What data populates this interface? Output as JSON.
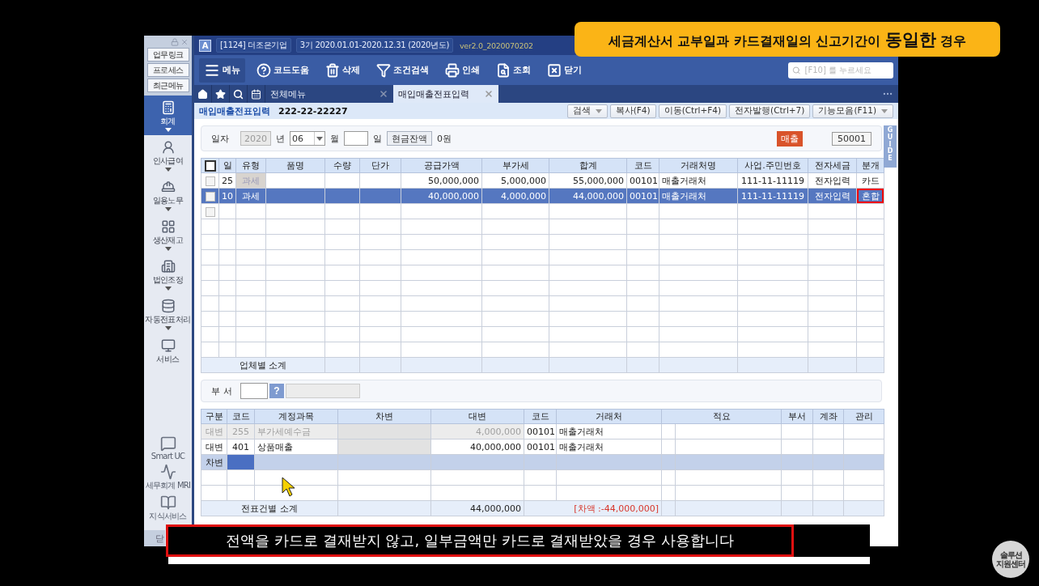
{
  "sidebar": {
    "quick_buttons": [
      "업무링크",
      "프로세스",
      "최근메뉴"
    ],
    "modules": [
      {
        "label": "회계",
        "selected": true,
        "has_menu": true
      },
      {
        "label": "인사급여",
        "selected": false,
        "has_menu": true
      },
      {
        "label": "일용노무",
        "selected": false,
        "has_menu": true
      },
      {
        "label": "생산재고",
        "selected": false,
        "has_menu": true
      },
      {
        "label": "법인조정",
        "selected": false,
        "has_menu": true
      },
      {
        "label": "자동전표처리",
        "selected": false,
        "has_menu": true
      },
      {
        "label": "서비스",
        "selected": false,
        "has_menu": false
      }
    ],
    "services": [
      "Smart UC",
      "세무회계 MRI",
      "지식서비스"
    ],
    "close_label": "닫"
  },
  "title_bar": {
    "logo": "A",
    "company": "[1124] 더조은기업",
    "period": "3기  2020.01.01-2020.12.31  (2020년도)",
    "version": "ver2.0_2020070202"
  },
  "toolbar": {
    "buttons": [
      "메뉴",
      "코드도움",
      "삭제",
      "조건검색",
      "인쇄",
      "조회",
      "닫기"
    ],
    "search_placeholder": "[F10] 를 누르세요"
  },
  "tabs": [
    {
      "label": "전체메뉴",
      "selected": false
    },
    {
      "label": "매입매출전표입력",
      "selected": true
    }
  ],
  "screen": {
    "title": "매입매출전표입력",
    "business_no": "222-22-22227",
    "actions": [
      {
        "label": "검색",
        "dropdown": true
      },
      {
        "label": "복사(F4)",
        "dropdown": false
      },
      {
        "label": "이동(Ctrl+F4)",
        "dropdown": false
      },
      {
        "label": "전자발행(Ctrl+7)",
        "dropdown": false
      },
      {
        "label": "기능모음(F11)",
        "dropdown": true
      }
    ]
  },
  "date_form": {
    "label": "일자",
    "year": "2020",
    "year_unit": "년",
    "month": "06",
    "month_unit": "월",
    "day_unit": "일",
    "cash_button": "현금잔액",
    "cash_balance": "0원",
    "sales_badge": "매출",
    "number": "50001"
  },
  "guide_tab": "GUIDE",
  "sales_table": {
    "columns": [
      "일",
      "유형",
      "품명",
      "수량",
      "단가",
      "공급가액",
      "부가세",
      "합계",
      "코드",
      "거래처명",
      "사업.주민번호",
      "전자세금",
      "분개"
    ],
    "header_checked": false,
    "rows": [
      {
        "checked": false,
        "selected": false,
        "type_locked": true,
        "journal_outlined": false,
        "day": "25",
        "type": "과세",
        "supply": "50,000,000",
        "vat": "5,000,000",
        "total": "55,000,000",
        "code": "00101",
        "partner": "매출거래처",
        "reg_no": "111-11-11119",
        "e_tax": "전자입력",
        "journal": "카드"
      },
      {
        "checked": false,
        "selected": true,
        "type_locked": false,
        "journal_outlined": true,
        "day": "10",
        "type": "과세",
        "supply": "40,000,000",
        "vat": "4,000,000",
        "total": "44,000,000",
        "code": "00101",
        "partner": "매출거래처",
        "reg_no": "111-11-11119",
        "e_tax": "전자입력",
        "journal": "혼합"
      },
      {
        "checked": false,
        "selected": false,
        "type_locked": false,
        "journal_outlined": false
      }
    ],
    "footer": "업체별 소계"
  },
  "department": {
    "label": "부서",
    "help": "?"
  },
  "journal_table": {
    "columns": [
      "구분",
      "코드",
      "계정과목",
      "차변",
      "대변",
      "코드",
      "거래처",
      "적요",
      "부서",
      "계좌",
      "관리"
    ],
    "rows": [
      {
        "side": "대변",
        "code": "255",
        "account": "부가세예수금",
        "credit": "4,000,000",
        "partner_code": "00101",
        "partner": "매출거래처",
        "disabled": true,
        "debit_locked": true,
        "selected": false
      },
      {
        "side": "대변",
        "code": "401",
        "account": "상품매출",
        "credit": "40,000,000",
        "partner_code": "00101",
        "partner": "매출거래처",
        "disabled": false,
        "debit_locked": true,
        "selected": false
      },
      {
        "side": "차변",
        "disabled": false,
        "debit_locked": false,
        "selected": true
      }
    ],
    "footer": {
      "label": "전표건별 소계",
      "credit_total": "44,000,000",
      "difference": "[차액 :-44,000,000]"
    }
  },
  "banner": "세금계산서 교부일과 카드결재일의 신고기간이 **동일한** 경우",
  "subtitle": "전액을 카드로 결재받지 않고, 일부금액만 카드로 결재받았을 경우 사용합니다",
  "channel_logo": [
    "솔루션",
    "지원센터"
  ]
}
